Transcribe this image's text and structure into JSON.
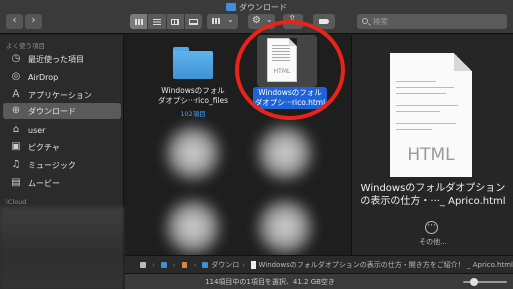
{
  "window": {
    "title": "ダウンロード"
  },
  "toolbar": {
    "back_glyph": "‹",
    "forward_glyph": "›",
    "action_glyph": "⚙",
    "share_glyph": "⇪",
    "search_placeholder": "検索"
  },
  "sidebar": {
    "favorites_header": "よく使う項目",
    "items": [
      {
        "label": "最近使った項目",
        "icon": "clock-icon"
      },
      {
        "label": "AirDrop",
        "icon": "airdrop-icon"
      },
      {
        "label": "アプリケーション",
        "icon": "apps-icon"
      },
      {
        "label": "ダウンロード",
        "icon": "download-icon"
      },
      {
        "label": "user",
        "icon": "home-icon"
      },
      {
        "label": "ピクチャ",
        "icon": "camera-icon"
      },
      {
        "label": "ミュージック",
        "icon": "music-icon"
      },
      {
        "label": "ムービー",
        "icon": "film-icon"
      }
    ],
    "icloud_header": "iCloud"
  },
  "files": [
    {
      "name_line1": "Windowsのフォル",
      "name_line2": "ダオプシ···rico_files",
      "sub": "102項目"
    },
    {
      "name_line1": "Windowsのフォル",
      "name_line2": "ダオプシ···rico.html",
      "thumb_text": "HTML"
    }
  ],
  "pathbar": {
    "crumb1": "ダウンロ",
    "file": "Windowsのフォルダオプションの表示の仕方・開き方をご紹介！ _ Aprico.html"
  },
  "preview": {
    "doc_text": "HTML",
    "title": "Windowsのフォルダオプション\nの表示の仕方・···_ Aprico.html",
    "more_glyph": "···",
    "more_label": "その他..."
  },
  "status": {
    "text": "114項目中の1項目を選択、41.2 GB空き",
    "icon_size_fraction": 0.25
  },
  "colors": {
    "selection": "#1f63d6",
    "folder": "#3f92d5",
    "annotation_ring": "#e8231a"
  }
}
